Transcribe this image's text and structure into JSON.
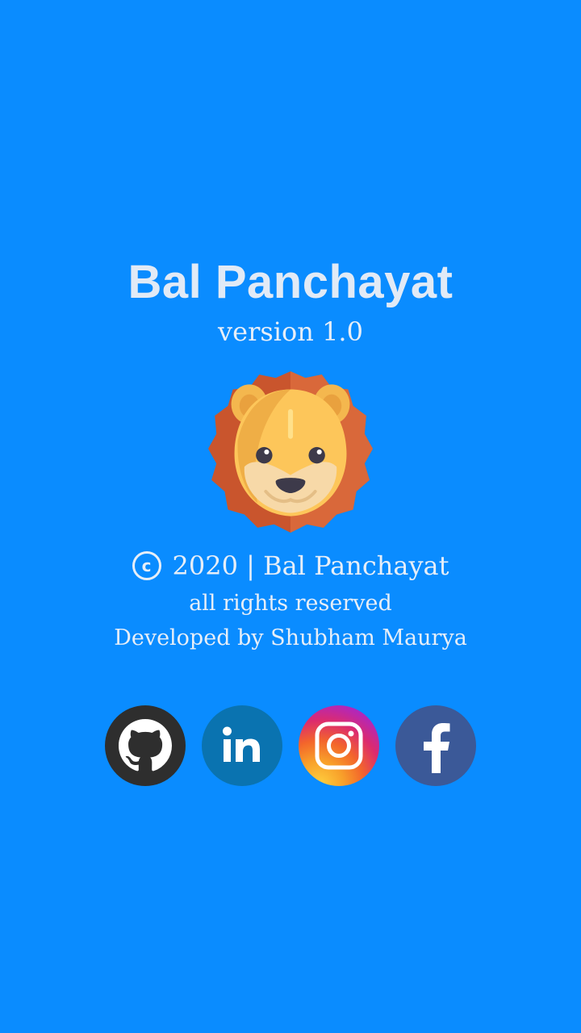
{
  "app": {
    "title": "Bal Panchayat",
    "version": "version 1.0"
  },
  "logo": {
    "icon": "lion-icon"
  },
  "footer": {
    "copyright_symbol": "c",
    "copyright_text": "2020 | Bal Panchayat",
    "rights": "all rights reserved",
    "developer": "Developed by Shubham Maurya"
  },
  "socials": [
    {
      "name": "github",
      "icon": "github-icon",
      "color": "#2E2E2E"
    },
    {
      "name": "linkedin",
      "icon": "linkedin-icon",
      "color": "#0A73B0"
    },
    {
      "name": "instagram",
      "icon": "instagram-icon",
      "color": "#DC2B6E"
    },
    {
      "name": "facebook",
      "icon": "facebook-icon",
      "color": "#3B5998"
    }
  ],
  "colors": {
    "background": "#0A8CFF",
    "text": "#E6EEF8"
  }
}
